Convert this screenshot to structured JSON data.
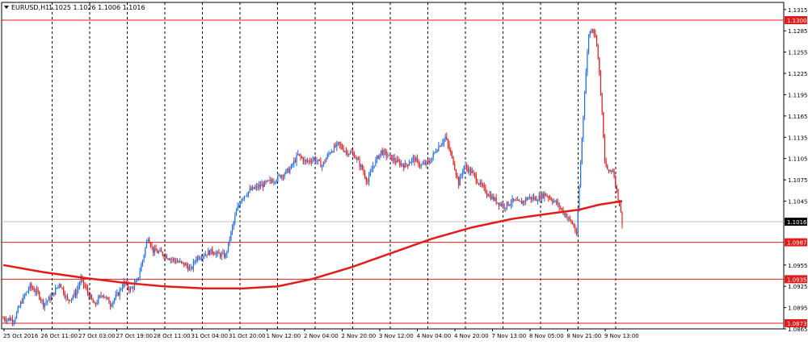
{
  "header": {
    "symbol_label": "EURUSD,H1",
    "ohlc_label": "1.1025 1.1026 1.1006 1.1016"
  },
  "colors": {
    "up_candle": "#1f6fe6",
    "down_candle": "#e41b1b",
    "moving_average": "#e41b1b",
    "level_line": "#e41b1b",
    "grid": "#000000",
    "current_price_line": "#c0c0c0"
  },
  "chart_data": {
    "type": "candlestick",
    "symbol": "EURUSD",
    "timeframe": "H1",
    "ylim": [
      1.0865,
      1.1325
    ],
    "y_ticks": [
      "1.1315",
      "1.1285",
      "1.1255",
      "1.1225",
      "1.1195",
      "1.1165",
      "1.1135",
      "1.1105",
      "1.1075",
      "1.1045",
      "1.0955",
      "1.0925",
      "1.0895",
      "1.0865"
    ],
    "x_tick_labels": [
      "25 Oct 2016",
      "26 Oct 11:00",
      "27 Oct 03:00",
      "27 Oct 19:00",
      "28 Oct 11:00",
      "31 Oct 04:00",
      "31 Oct 20:00",
      "1 Nov 12:00",
      "2 Nov 04:00",
      "2 Nov 20:00",
      "3 Nov 12:00",
      "4 Nov 04:00",
      "4 Nov 20:00",
      "7 Nov 13:00",
      "8 Nov 05:00",
      "8 Nov 21:00",
      "9 Nov 13:00"
    ],
    "horizontal_levels": [
      {
        "value": 1.13,
        "label": "1.1300"
      },
      {
        "value": 1.0987,
        "label": "1.0987"
      },
      {
        "value": 1.0935,
        "label": "1.0935"
      },
      {
        "value": 1.0873,
        "label": "1.0873"
      }
    ],
    "current_price": {
      "value": 1.1016,
      "label": "1.1016"
    },
    "price_path": [
      [
        0,
        1.088
      ],
      [
        8,
        1.0878
      ],
      [
        14,
        1.0905
      ],
      [
        20,
        1.0925
      ],
      [
        26,
        1.0915
      ],
      [
        30,
        1.09
      ],
      [
        36,
        1.091
      ],
      [
        42,
        1.093
      ],
      [
        48,
        1.0905
      ],
      [
        54,
        1.0915
      ],
      [
        58,
        1.0935
      ],
      [
        62,
        1.092
      ],
      [
        68,
        1.0898
      ],
      [
        74,
        1.0915
      ],
      [
        80,
        1.09
      ],
      [
        86,
        1.0915
      ],
      [
        90,
        1.093
      ],
      [
        95,
        1.092
      ],
      [
        100,
        1.0932
      ],
      [
        104,
        1.0962
      ],
      [
        108,
        1.0995
      ],
      [
        112,
        1.0975
      ],
      [
        118,
        1.0972
      ],
      [
        124,
        1.0965
      ],
      [
        130,
        1.096
      ],
      [
        136,
        1.0955
      ],
      [
        140,
        1.0948
      ],
      [
        144,
        1.0965
      ],
      [
        150,
        1.097
      ],
      [
        156,
        1.0975
      ],
      [
        160,
        1.097
      ],
      [
        166,
        1.0968
      ],
      [
        170,
        1.1
      ],
      [
        174,
        1.103
      ],
      [
        178,
        1.105
      ],
      [
        184,
        1.106
      ],
      [
        190,
        1.1065
      ],
      [
        196,
        1.107
      ],
      [
        202,
        1.1075
      ],
      [
        208,
        1.1082
      ],
      [
        214,
        1.109
      ],
      [
        220,
        1.111
      ],
      [
        226,
        1.11
      ],
      [
        232,
        1.1105
      ],
      [
        238,
        1.1095
      ],
      [
        244,
        1.1115
      ],
      [
        250,
        1.1125
      ],
      [
        256,
        1.1115
      ],
      [
        262,
        1.111
      ],
      [
        268,
        1.109
      ],
      [
        272,
        1.1072
      ],
      [
        276,
        1.1095
      ],
      [
        282,
        1.1115
      ],
      [
        288,
        1.1108
      ],
      [
        294,
        1.11
      ],
      [
        300,
        1.1095
      ],
      [
        306,
        1.1105
      ],
      [
        312,
        1.1095
      ],
      [
        318,
        1.11
      ],
      [
        324,
        1.112
      ],
      [
        330,
        1.1135
      ],
      [
        336,
        1.11
      ],
      [
        340,
        1.107
      ],
      [
        344,
        1.1095
      ],
      [
        350,
        1.1085
      ],
      [
        356,
        1.1068
      ],
      [
        362,
        1.1055
      ],
      [
        368,
        1.1045
      ],
      [
        374,
        1.1038
      ],
      [
        380,
        1.1045
      ],
      [
        386,
        1.1042
      ],
      [
        392,
        1.105
      ],
      [
        398,
        1.1048
      ],
      [
        404,
        1.1055
      ],
      [
        408,
        1.105
      ],
      [
        414,
        1.104
      ],
      [
        418,
        1.103
      ],
      [
        422,
        1.102
      ],
      [
        426,
        1.101
      ],
      [
        428,
        1.0995
      ],
      [
        431,
        1.11
      ],
      [
        434,
        1.12
      ],
      [
        437,
        1.128
      ],
      [
        440,
        1.129
      ],
      [
        443,
        1.127
      ],
      [
        446,
        1.12
      ],
      [
        449,
        1.11
      ],
      [
        452,
        1.1085
      ],
      [
        455,
        1.109
      ],
      [
        458,
        1.106
      ],
      [
        460,
        1.104
      ],
      [
        462,
        1.1016
      ]
    ],
    "moving_average_path": [
      [
        0,
        1.0955
      ],
      [
        30,
        1.0945
      ],
      [
        60,
        1.0937
      ],
      [
        90,
        1.093
      ],
      [
        120,
        1.0925
      ],
      [
        150,
        1.0922
      ],
      [
        180,
        1.0922
      ],
      [
        205,
        1.0925
      ],
      [
        230,
        1.0935
      ],
      [
        260,
        1.0952
      ],
      [
        290,
        1.0972
      ],
      [
        320,
        1.0992
      ],
      [
        350,
        1.1008
      ],
      [
        380,
        1.102
      ],
      [
        410,
        1.1028
      ],
      [
        430,
        1.1033
      ],
      [
        445,
        1.104
      ],
      [
        462,
        1.1045
      ]
    ]
  }
}
